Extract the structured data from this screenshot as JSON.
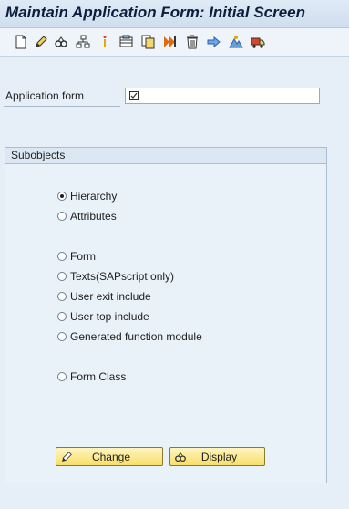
{
  "window": {
    "title": "Maintain Application Form: Initial Screen"
  },
  "toolbar": {
    "icons": [
      "create-icon",
      "change-icon",
      "display-icon",
      "hierarchy-icon",
      "info-icon",
      "copy-icon",
      "rename-icon",
      "check-icon",
      "delete-icon",
      "where-used-icon",
      "transport-icon",
      "truck-icon"
    ]
  },
  "app_form": {
    "label": "Application form",
    "value": ""
  },
  "subobjects": {
    "header": "Subobjects",
    "options": [
      {
        "label": "Hierarchy",
        "selected": true
      },
      {
        "label": "Attributes",
        "selected": false
      },
      {
        "label": "Form",
        "selected": false
      },
      {
        "label": "Texts(SAPscript only)",
        "selected": false
      },
      {
        "label": "User exit include",
        "selected": false
      },
      {
        "label": "User top include",
        "selected": false
      },
      {
        "label": "Generated function module",
        "selected": false
      },
      {
        "label": "Form Class",
        "selected": false
      }
    ]
  },
  "buttons": {
    "change": "Change",
    "display": "Display"
  },
  "colors": {
    "accent": "#f7df6a",
    "background": "#e6eff8",
    "title": "#0c1f3a"
  }
}
